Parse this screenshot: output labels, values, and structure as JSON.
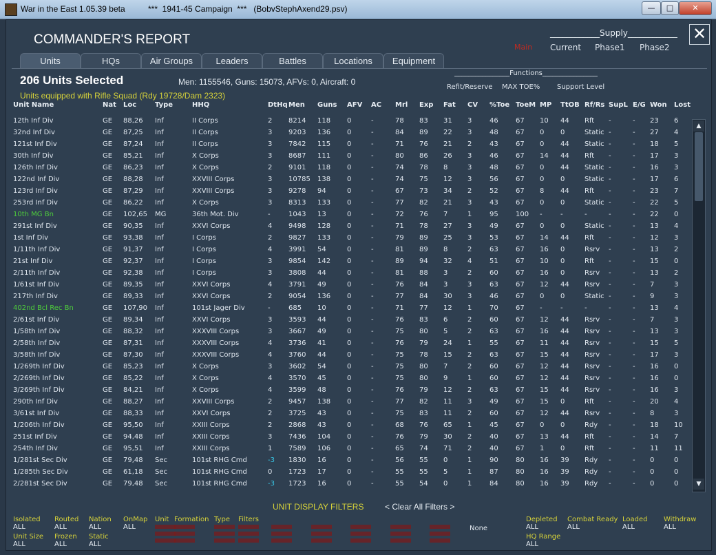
{
  "window": {
    "title": "War in the East 1.05.39 beta          ***  1941-45 Campaign  ***   (BobvStephAxend29.psv)",
    "btn_min": "—",
    "btn_max": "□",
    "btn_close": "✕"
  },
  "report": {
    "title": "COMMANDER'S REPORT",
    "close_glyph": "✕",
    "supply_label": "Supply",
    "supply_cols": [
      "Main",
      "Current",
      "Phase1",
      "Phase2"
    ],
    "tabs": [
      "Units",
      "HQs",
      "Air Groups",
      "Leaders",
      "Battles",
      "Locations",
      "Equipment"
    ],
    "active_tab": "Units",
    "selected": "206 Units Selected",
    "stats": "Men: 1155546, Guns: 15073, AFVs: 0, Aircraft: 0",
    "equip_filter": "Units equipped with Rifle Squad (Rdy 19728/Dam 2323)",
    "functions_label": "Functions",
    "functions": [
      "Refit/Reserve",
      "MAX TOE%",
      "Support Level"
    ]
  },
  "table": {
    "headers": [
      "Unit Name",
      "Nat",
      "Loc",
      "Type",
      "HHQ",
      "DtHq",
      "Men",
      "Guns",
      "AFV",
      "AC",
      "Mrl",
      "Exp",
      "Fat",
      "CV",
      "%Toe",
      "ToeM",
      "MP",
      "TtOB",
      "Rf/Rs",
      "SupL",
      "E/G",
      "Won",
      "Lost"
    ],
    "rows": [
      [
        "12th Inf Div",
        "GE",
        "88,26",
        "Inf",
        "II Corps",
        "2",
        "8214",
        "118",
        "0",
        "-",
        "78",
        "83",
        "31",
        "3",
        "46",
        "67",
        "10",
        "44",
        "Rft",
        "-",
        "-",
        "23",
        "6"
      ],
      [
        "32nd Inf Div",
        "GE",
        "87,25",
        "Inf",
        "II Corps",
        "3",
        "9203",
        "136",
        "0",
        "-",
        "84",
        "89",
        "22",
        "3",
        "48",
        "67",
        "0",
        "0",
        "Static",
        "-",
        "-",
        "27",
        "4"
      ],
      [
        "121st Inf Div",
        "GE",
        "87,24",
        "Inf",
        "II Corps",
        "3",
        "7842",
        "115",
        "0",
        "-",
        "71",
        "76",
        "21",
        "2",
        "43",
        "67",
        "0",
        "44",
        "Static",
        "-",
        "-",
        "18",
        "5"
      ],
      [
        "30th Inf Div",
        "GE",
        "85,21",
        "Inf",
        "X Corps",
        "3",
        "8687",
        "111",
        "0",
        "-",
        "80",
        "86",
        "26",
        "3",
        "46",
        "67",
        "14",
        "44",
        "Rft",
        "-",
        "-",
        "17",
        "3"
      ],
      [
        "126th Inf Div",
        "GE",
        "86,23",
        "Inf",
        "X Corps",
        "2",
        "9101",
        "118",
        "0",
        "-",
        "74",
        "78",
        "8",
        "3",
        "48",
        "67",
        "0",
        "44",
        "Static",
        "-",
        "-",
        "16",
        "3"
      ],
      [
        "122nd Inf Div",
        "GE",
        "88,28",
        "Inf",
        "XXVIII Corps",
        "3",
        "10785",
        "138",
        "0",
        "-",
        "74",
        "75",
        "12",
        "3",
        "56",
        "67",
        "0",
        "0",
        "Static",
        "-",
        "-",
        "17",
        "6"
      ],
      [
        "123rd Inf Div",
        "GE",
        "87,29",
        "Inf",
        "XXVIII Corps",
        "3",
        "9278",
        "94",
        "0",
        "-",
        "67",
        "73",
        "34",
        "2",
        "52",
        "67",
        "8",
        "44",
        "Rft",
        "-",
        "-",
        "23",
        "7"
      ],
      [
        "253rd Inf Div",
        "GE",
        "86,22",
        "Inf",
        "X Corps",
        "3",
        "8313",
        "133",
        "0",
        "-",
        "77",
        "82",
        "21",
        "3",
        "43",
        "67",
        "0",
        "0",
        "Static",
        "-",
        "-",
        "22",
        "5"
      ],
      [
        "10th MG Bn",
        "GE",
        "102,65",
        "MG",
        "36th Mot. Div",
        "-",
        "1043",
        "13",
        "0",
        "-",
        "72",
        "76",
        "7",
        "1",
        "95",
        "100",
        "-",
        "-",
        "-",
        "-",
        "-",
        "22",
        "0"
      ],
      [
        "291st Inf Div",
        "GE",
        "90,35",
        "Inf",
        "XXVI Corps",
        "4",
        "9498",
        "128",
        "0",
        "-",
        "71",
        "78",
        "27",
        "3",
        "49",
        "67",
        "0",
        "0",
        "Static",
        "-",
        "-",
        "13",
        "4"
      ],
      [
        "1st Inf Div",
        "GE",
        "93,38",
        "Inf",
        "I Corps",
        "2",
        "9827",
        "133",
        "0",
        "-",
        "79",
        "89",
        "25",
        "3",
        "53",
        "67",
        "14",
        "44",
        "Rft",
        "-",
        "-",
        "12",
        "3"
      ],
      [
        "1/11th Inf Div",
        "GE",
        "91,37",
        "Inf",
        "I Corps",
        "4",
        "3991",
        "54",
        "0",
        "-",
        "81",
        "89",
        "8",
        "2",
        "63",
        "67",
        "16",
        "0",
        "Rsrv",
        "-",
        "-",
        "13",
        "2"
      ],
      [
        "21st Inf Div",
        "GE",
        "92,37",
        "Inf",
        "I Corps",
        "3",
        "9854",
        "142",
        "0",
        "-",
        "89",
        "94",
        "32",
        "4",
        "51",
        "67",
        "10",
        "0",
        "Rft",
        "-",
        "-",
        "15",
        "0"
      ],
      [
        "2/11th Inf Div",
        "GE",
        "92,38",
        "Inf",
        "I Corps",
        "3",
        "3808",
        "44",
        "0",
        "-",
        "81",
        "88",
        "3",
        "2",
        "60",
        "67",
        "16",
        "0",
        "Rsrv",
        "-",
        "-",
        "13",
        "2"
      ],
      [
        "1/61st Inf Div",
        "GE",
        "89,35",
        "Inf",
        "XXVI Corps",
        "4",
        "3791",
        "49",
        "0",
        "-",
        "76",
        "84",
        "3",
        "3",
        "63",
        "67",
        "12",
        "44",
        "Rsrv",
        "-",
        "-",
        "7",
        "3"
      ],
      [
        "217th Inf Div",
        "GE",
        "89,33",
        "Inf",
        "XXVI Corps",
        "2",
        "9054",
        "136",
        "0",
        "-",
        "77",
        "84",
        "30",
        "3",
        "46",
        "67",
        "0",
        "0",
        "Static",
        "-",
        "-",
        "9",
        "3"
      ],
      [
        "402nd Bcl Rec Bn",
        "GE",
        "107,90",
        "Inf",
        "101st Jager Div",
        "-",
        "685",
        "10",
        "0",
        "-",
        "71",
        "77",
        "12",
        "1",
        "70",
        "67",
        "-",
        "-",
        "-",
        "-",
        "-",
        "13",
        "4"
      ],
      [
        "2/61st Inf Div",
        "GE",
        "89,34",
        "Inf",
        "XXVI Corps",
        "3",
        "3593",
        "44",
        "0",
        "-",
        "76",
        "83",
        "6",
        "2",
        "60",
        "67",
        "12",
        "44",
        "Rsrv",
        "-",
        "-",
        "7",
        "3"
      ],
      [
        "1/58th Inf Div",
        "GE",
        "88,32",
        "Inf",
        "XXXVIII Corps",
        "3",
        "3667",
        "49",
        "0",
        "-",
        "75",
        "80",
        "5",
        "2",
        "63",
        "67",
        "16",
        "44",
        "Rsrv",
        "-",
        "-",
        "13",
        "3"
      ],
      [
        "2/58th Inf Div",
        "GE",
        "87,31",
        "Inf",
        "XXXVIII Corps",
        "4",
        "3736",
        "41",
        "0",
        "-",
        "76",
        "79",
        "24",
        "1",
        "55",
        "67",
        "11",
        "44",
        "Rsrv",
        "-",
        "-",
        "15",
        "5"
      ],
      [
        "3/58th Inf Div",
        "GE",
        "87,30",
        "Inf",
        "XXXVIII Corps",
        "4",
        "3760",
        "44",
        "0",
        "-",
        "75",
        "78",
        "15",
        "2",
        "63",
        "67",
        "15",
        "44",
        "Rsrv",
        "-",
        "-",
        "17",
        "3"
      ],
      [
        "1/269th Inf Div",
        "GE",
        "85,23",
        "Inf",
        "X Corps",
        "3",
        "3602",
        "54",
        "0",
        "-",
        "75",
        "80",
        "7",
        "2",
        "60",
        "67",
        "12",
        "44",
        "Rsrv",
        "-",
        "-",
        "16",
        "0"
      ],
      [
        "2/269th Inf Div",
        "GE",
        "85,22",
        "Inf",
        "X Corps",
        "4",
        "3570",
        "45",
        "0",
        "-",
        "75",
        "80",
        "9",
        "1",
        "60",
        "67",
        "12",
        "44",
        "Rsrv",
        "-",
        "-",
        "16",
        "0"
      ],
      [
        "3/269th Inf Div",
        "GE",
        "84,21",
        "Inf",
        "X Corps",
        "4",
        "3599",
        "48",
        "0",
        "-",
        "76",
        "79",
        "12",
        "2",
        "63",
        "67",
        "15",
        "44",
        "Rsrv",
        "-",
        "-",
        "16",
        "3"
      ],
      [
        "290th Inf Div",
        "GE",
        "88,27",
        "Inf",
        "XXVIII Corps",
        "2",
        "9457",
        "138",
        "0",
        "-",
        "77",
        "82",
        "11",
        "3",
        "49",
        "67",
        "15",
        "0",
        "Rft",
        "-",
        "-",
        "20",
        "4"
      ],
      [
        "3/61st Inf Div",
        "GE",
        "88,33",
        "Inf",
        "XXVI Corps",
        "2",
        "3725",
        "43",
        "0",
        "-",
        "75",
        "83",
        "11",
        "2",
        "60",
        "67",
        "12",
        "44",
        "Rsrv",
        "-",
        "-",
        "8",
        "3"
      ],
      [
        "1/206th Inf Div",
        "GE",
        "95,50",
        "Inf",
        "XXIII Corps",
        "2",
        "2868",
        "43",
        "0",
        "-",
        "68",
        "76",
        "65",
        "1",
        "45",
        "67",
        "0",
        "0",
        "Rdy",
        "-",
        "-",
        "18",
        "10"
      ],
      [
        "251st Inf Div",
        "GE",
        "94,48",
        "Inf",
        "XXIII Corps",
        "3",
        "7436",
        "104",
        "0",
        "-",
        "76",
        "79",
        "30",
        "2",
        "40",
        "67",
        "13",
        "44",
        "Rft",
        "-",
        "-",
        "14",
        "7"
      ],
      [
        "254th Inf Div",
        "GE",
        "95,51",
        "Inf",
        "XXIII Corps",
        "1",
        "7589",
        "106",
        "0",
        "-",
        "65",
        "74",
        "71",
        "2",
        "40",
        "67",
        "1",
        "0",
        "Rft",
        "-",
        "-",
        "11",
        "11"
      ],
      [
        "1/281st Sec Div",
        "GE",
        "79,48",
        "Sec",
        "101st RHG Cmd",
        "-3",
        "1830",
        "16",
        "0",
        "-",
        "56",
        "55",
        "0",
        "1",
        "90",
        "80",
        "16",
        "39",
        "Rdy",
        "-",
        "-",
        "0",
        "0"
      ],
      [
        "1/285th Sec Div",
        "GE",
        "61,18",
        "Sec",
        "101st RHG Cmd",
        "0",
        "1723",
        "17",
        "0",
        "-",
        "55",
        "55",
        "5",
        "1",
        "87",
        "80",
        "16",
        "39",
        "Rdy",
        "-",
        "-",
        "0",
        "0"
      ],
      [
        "2/281st Sec Div",
        "GE",
        "79,48",
        "Sec",
        "101st RHG Cmd",
        "-3",
        "1723",
        "16",
        "0",
        "-",
        "55",
        "54",
        "0",
        "1",
        "84",
        "80",
        "16",
        "39",
        "Rdy",
        "-",
        "-",
        "0",
        "0"
      ]
    ],
    "highlight_rows": [
      8,
      16
    ],
    "cyan_dthq_rows": [
      29,
      31
    ],
    "scroll_up": "▲",
    "scroll_down": "▼"
  },
  "filters": {
    "title": "UNIT DISPLAY FILTERS",
    "clear": "< Clear All Filters >",
    "items": [
      {
        "label": "Isolated",
        "value": "ALL"
      },
      {
        "label": "Routed",
        "value": "ALL"
      },
      {
        "label": "Nation",
        "value": "ALL"
      },
      {
        "label": "OnMap",
        "value": "ALL"
      },
      {
        "label": "Unit Size",
        "value": "ALL"
      },
      {
        "label": "Frozen",
        "value": "ALL"
      },
      {
        "label": "Static",
        "value": "ALL"
      },
      {
        "label": "Unit",
        "value": ""
      },
      {
        "label": "Formation",
        "value": ""
      },
      {
        "label": "Type",
        "value": ""
      },
      {
        "label": "Filters",
        "value": ""
      },
      {
        "label": "Depleted",
        "value": "ALL"
      },
      {
        "label": "Combat Ready",
        "value": "ALL"
      },
      {
        "label": "Loaded",
        "value": "ALL"
      },
      {
        "label": "Withdraw",
        "value": "ALL"
      },
      {
        "label": "HQ Range",
        "value": "ALL"
      }
    ],
    "none_label": "None"
  },
  "colors": {
    "bg": "#2f3f50",
    "text": "#dfe6ee",
    "yellow": "#d6d23a",
    "green": "#4ecb3c",
    "cyan": "#38c8e8",
    "red": "#a81e1e"
  }
}
